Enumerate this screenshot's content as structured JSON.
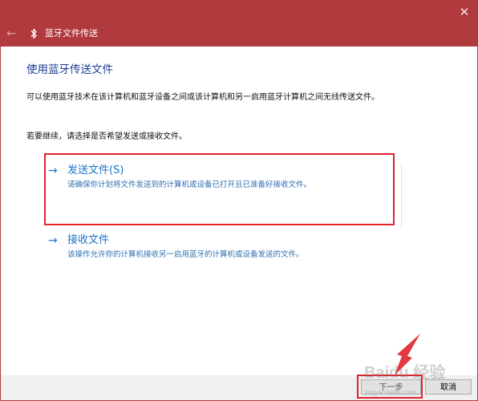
{
  "window": {
    "title": "蓝牙文件传送",
    "close_glyph": "✕",
    "back_glyph": "←"
  },
  "main": {
    "heading": "使用蓝牙传送文件",
    "description": "可以使用蓝牙技术在该计算机和蓝牙设备之间或该计算机和另一启用蓝牙计算机之间无线传送文件。",
    "prompt": "若要继续，请选择是否希望发送或接收文件。"
  },
  "options": {
    "send": {
      "arrow": "→",
      "title": "发送文件(S)",
      "description": "请确保你计划将文件发送到的计算机或设备已打开且已准备好接收文件。"
    },
    "receive": {
      "arrow": "→",
      "title": "接收文件",
      "description": "该操作允许你的计算机接收另一启用蓝牙的计算机或设备发送的文件。"
    }
  },
  "footer": {
    "next_label": "下一步",
    "cancel_label": "取消"
  },
  "watermark": {
    "text": "Baidu 经验",
    "sub": "jingyan.baidu.com"
  },
  "colors": {
    "titlebar": "#b03a3e",
    "accent": "#1a73c8",
    "heading": "#1f3f99",
    "annotation": "#e0232a"
  },
  "icons": {
    "bluetooth": "bluetooth-icon",
    "back": "back-arrow-icon",
    "close": "close-icon"
  }
}
